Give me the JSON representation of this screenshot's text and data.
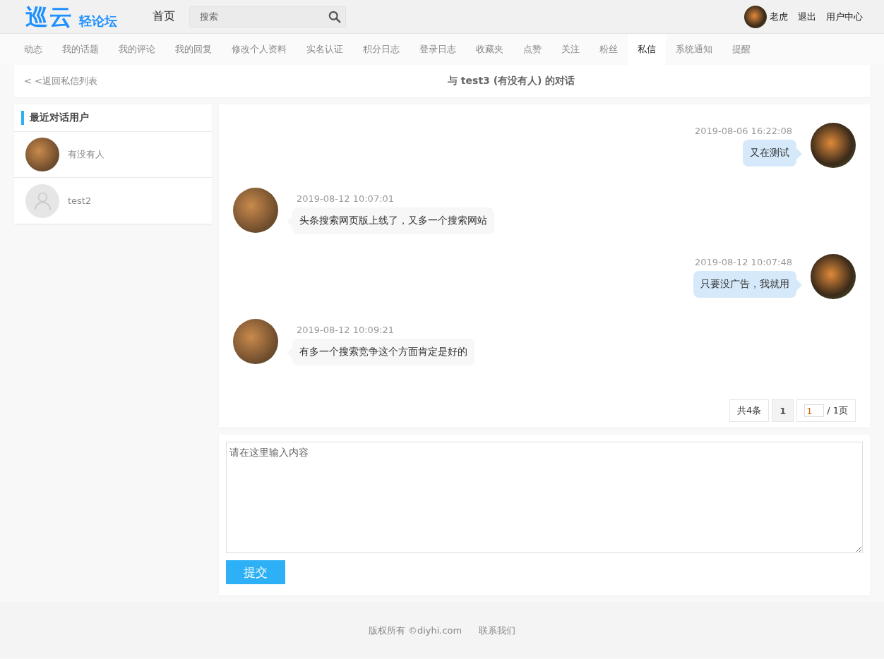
{
  "header": {
    "logo_main": "巡云",
    "logo_sub": "轻论坛",
    "home_link": "首页",
    "search": {
      "placeholder": "搜索"
    },
    "user": {
      "name": "老虎"
    },
    "logout": "退出",
    "user_center": "用户中心"
  },
  "tabs": [
    {
      "label": "动态",
      "selected": false
    },
    {
      "label": "我的话题",
      "selected": false
    },
    {
      "label": "我的评论",
      "selected": false
    },
    {
      "label": "我的回复",
      "selected": false
    },
    {
      "label": "修改个人资料",
      "selected": false
    },
    {
      "label": "实名认证",
      "selected": false
    },
    {
      "label": "积分日志",
      "selected": false
    },
    {
      "label": "登录日志",
      "selected": false
    },
    {
      "label": "收藏夹",
      "selected": false
    },
    {
      "label": "点赞",
      "selected": false
    },
    {
      "label": "关注",
      "selected": false
    },
    {
      "label": "粉丝",
      "selected": false
    },
    {
      "label": "私信",
      "selected": true
    },
    {
      "label": "系统通知",
      "selected": false
    },
    {
      "label": "提醒",
      "selected": false
    }
  ],
  "top_bar": {
    "back_link": "< <返回私信列表",
    "title": "与 test3 (有没有人) 的对话"
  },
  "sidebar": {
    "title": "最近对话用户",
    "items": [
      {
        "name": "有没有人",
        "kind": "photo"
      },
      {
        "name": "test2",
        "kind": "default"
      }
    ]
  },
  "messages": [
    {
      "kind": "sent",
      "time": "2019-08-06 16:22:08",
      "text": "又在测试"
    },
    {
      "kind": "received",
      "time": "2019-08-12 10:07:01",
      "text": "头条搜索网页版上线了，又多一个搜索网站"
    },
    {
      "kind": "sent",
      "time": "2019-08-12 10:07:48",
      "text": "只要没广告，我就用"
    },
    {
      "kind": "received",
      "time": "2019-08-12 10:09:21",
      "text": "有多一个搜索竞争这个方面肯定是好的"
    }
  ],
  "pagination": {
    "total": "共4条",
    "current": "1",
    "page_input": "1",
    "pages": "/ 1页"
  },
  "reply": {
    "placeholder": "请在这里输入内容",
    "submit": "提交"
  },
  "footer": {
    "copyright": "版权所有 ©diyhi.com",
    "contact": "联系我们"
  }
}
